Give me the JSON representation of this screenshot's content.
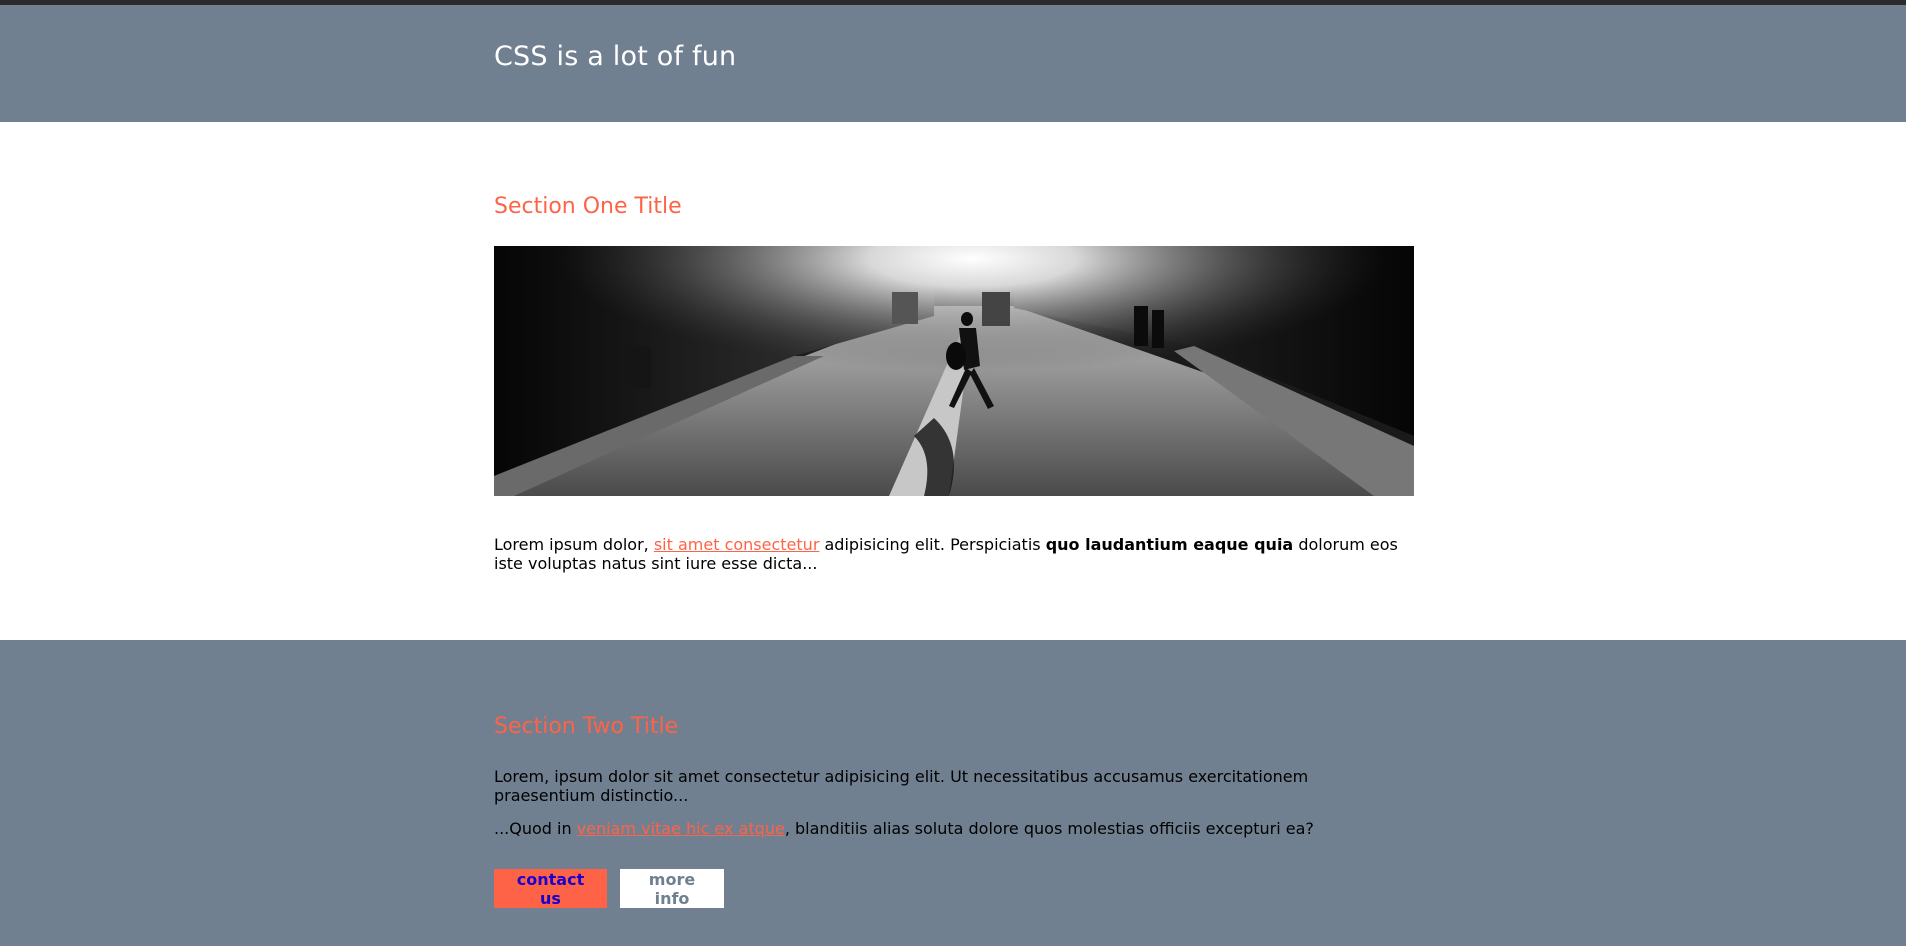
{
  "header": {
    "title": "CSS is a lot of fun"
  },
  "section_one": {
    "title": "Section One Title",
    "image_alt": "street scene",
    "text_before_link": "Lorem ipsum dolor, ",
    "link_text": "sit amet consectetur",
    "text_after_link": " adipisicing elit. Perspiciatis ",
    "bold_text": "quo laudantium eaque quia",
    "text_end": " dolorum eos iste voluptas natus sint iure esse dicta..."
  },
  "section_two": {
    "title": "Section Two Title",
    "paragraph1": "Lorem, ipsum dolor sit amet consectetur adipisicing elit. Ut necessitatibus accusamus exercitationem praesentium distinctio...",
    "p2_before_link": "...Quod in ",
    "p2_link": "veniam vitae hic ex atque",
    "p2_after_link": ", blanditiis alias soluta dolore quos molestias officiis excepturi ea?",
    "contact_button": "contact us",
    "more_button": "more info"
  },
  "colors": {
    "slate": "#708090",
    "tomato": "#ff6347"
  }
}
